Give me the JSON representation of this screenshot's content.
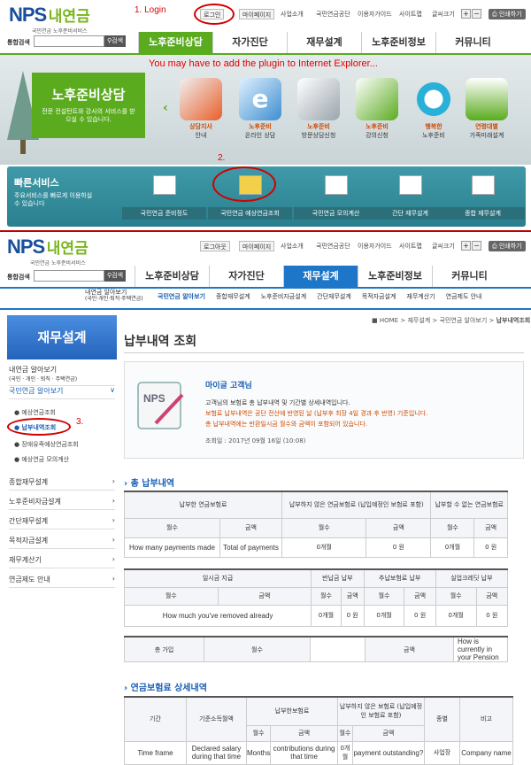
{
  "top1": {
    "logo_main": "NPS",
    "logo_kr": "내연금",
    "logo_sub": "국민연금 노후준비서비스",
    "annotation_login": "1. Login",
    "links": [
      "로그인",
      "마이페이지",
      "사업소개",
      "국민연금공단",
      "이용자가이드",
      "사이트맵"
    ],
    "font_size_label": "글씨크기",
    "print_label": "인쇄하기",
    "search_label": "통합검색",
    "search_btn": "검색",
    "nav": [
      "노후준비상담",
      "자가진단",
      "재무설계",
      "노후준비정보",
      "커뮤니티"
    ],
    "plugin_note": "You may have to add the plugin to Internet Explorer...",
    "banner_title": "노후준비상담",
    "banner_desc": "전문 컨설턴트와 강사의 서비스를 받으실 수 있습니다.",
    "banner_icons": [
      {
        "l1": "상담지사",
        "l2": "안내",
        "color": "#e85f2b"
      },
      {
        "l1": "노후준비",
        "l2": "온라인 상담",
        "color": "#3e8fcf"
      },
      {
        "l1": "노후준비",
        "l2": "방문상담신청",
        "color": "#9aa4ad"
      },
      {
        "l1": "노후준비",
        "l2": "강의신청",
        "color": "#5aab1e"
      },
      {
        "l1": "행복한",
        "l2": "노후준비",
        "color": "#28b0d8"
      },
      {
        "l1": "연령대별",
        "l2": "가족미래설계",
        "color": "#5aab1e"
      }
    ],
    "quick_title": "빠른서비스",
    "quick_desc": "주요서비스를 빠르게 이용하실 수 있습니다",
    "annotation_2": "2.",
    "quick_items": [
      "국민연금 준비정도",
      "국민연금 예상연금조회",
      "국민연금 모의계산",
      "간단 재무설계",
      "종합 재무설계"
    ]
  },
  "top2": {
    "logo_main": "NPS",
    "logo_kr": "내연금",
    "logo_sub": "국민연금 노후준비서비스",
    "links": [
      "로그아웃",
      "마이페이지",
      "사업소개",
      "국민연금공단",
      "이용자가이드",
      "사이트맵"
    ],
    "font_size_label": "글씨크기",
    "print_label": "인쇄하기",
    "search_label": "통합검색",
    "search_btn": "검색",
    "nav": [
      "노후준비상담",
      "자가진단",
      "재무설계",
      "노후준비정보",
      "커뮤니티"
    ],
    "subnav_head": "내연금 알아보기",
    "subnav_head2": "(국민·개인·퇴직·주택연금)",
    "subnav": [
      "국민연금 알아보기",
      "종합재무설계",
      "노후준비자금설계",
      "간단재무설계",
      "목적자금설계",
      "재무계산기",
      "연금제도 안내"
    ],
    "breadcrumb": [
      "HOME",
      "재무설계",
      "국민연금 알아보기",
      "납부내역조회"
    ]
  },
  "sidebar": {
    "title": "재무설계",
    "item1": "내연금 알아보기",
    "item1_sub": "(국민 · 개인 · 퇴직 · 주택연금)",
    "item2": "국민연금 알아보기",
    "subs": [
      "예상연금조회",
      "납부내역조회",
      "장애유족예상연금조회",
      "예상연금 모의계산"
    ],
    "annotation_3": "3.",
    "items": [
      "종합재무설계",
      "노후준비자금설계",
      "간단재무설계",
      "목적자금설계",
      "재무계산기",
      "연금제도 안내"
    ]
  },
  "main": {
    "title": "납부내역 조회",
    "card_logo": "NPS",
    "greeting": "마이글 고객님",
    "desc1": "고객님의 보험료 총 납부내역 및 기간별 상세내역입니다.",
    "desc2": "보험료 납부내역은 공단 전산에 반영된 날 (납부후 최장 4일 경과 후 반영) 기준입니다.",
    "desc3": "총 납부내역에는 반환일시금 월수와 금액이 포함되어 있습니다.",
    "date": "조회일 : 2017년 09월 16일 (10:08)",
    "section1": "총 납부내역",
    "t1_head": [
      "납부한 연금보험료",
      "납부하지 않은 연금보험료 (납입예정인 보험료 포함)",
      "납부할 수 없는 연금보험료"
    ],
    "t1_sub": [
      "월수",
      "금액",
      "월수",
      "금액",
      "월수",
      "금액"
    ],
    "t1_row": [
      "How many payments made",
      "Total of payments",
      "0개월",
      "0 원",
      "0개월",
      "0 원"
    ],
    "t2_head": [
      "일시금 지급",
      "반납금 납부",
      "추납보험료 납부",
      "실업크레딧 납부"
    ],
    "t2_sub": [
      "월수",
      "금액",
      "월수",
      "금액",
      "월수",
      "금액",
      "월수",
      "금액"
    ],
    "t2_row": [
      "How much you've removed already",
      "0개월",
      "0 원",
      "0개월",
      "0 원",
      "0개월",
      "0 원"
    ],
    "t3": [
      "총 가입",
      "월수",
      "금액",
      "How is currently in your Pension"
    ],
    "section2": "연금보험료 상세내역",
    "t4_head": [
      "기간",
      "기준소득월액",
      "납부한보험료",
      "납부하지 않은 보험료 (납입예정인 보험료 포함)",
      "종별",
      "비고"
    ],
    "t4_sub": [
      "월수",
      "금액",
      "월수",
      "금액"
    ],
    "t4_row": [
      "Time frame",
      "Declared salary during that time",
      "Months",
      "contributions during that time",
      "0개월",
      "payment outstanding?",
      "사업장",
      "Company name"
    ]
  }
}
